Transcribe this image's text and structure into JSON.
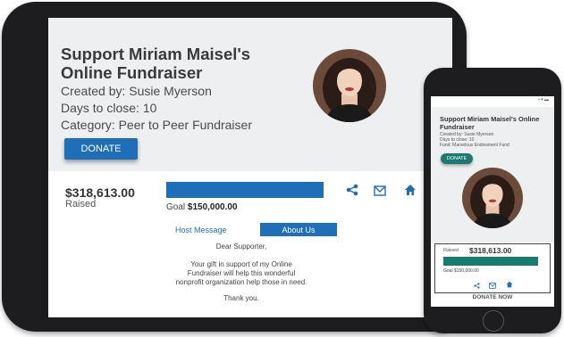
{
  "fundraiser": {
    "title": "Support Miriam Maisel's Online Fundraiser",
    "created_by": "Created by: Susie Myerson",
    "days_to_close": "Days to close: 10",
    "category": "Category: Peer to Peer Fundraiser",
    "donate_label": "DONATE",
    "raised_amount": "$318,613.00",
    "raised_label": "Raised",
    "goal_label": "Goal",
    "goal_amount": "$150,000.00",
    "progress_fraction": 1.0
  },
  "tabs": {
    "host_message": "Host Message",
    "about_us": "About Us"
  },
  "message": {
    "greeting": "Dear Supporter,",
    "body": "Your gift in support of my Online Fundraiser will help this wonderful nonprofit organization help those in need.",
    "closing": "Thank you."
  },
  "phone": {
    "title": "Support Miriam Maisel's Online Fundraiser",
    "created_by": "Created by: Susie Myerson",
    "days_to_close": "Days to close: 10",
    "fund": "Fund: Marvelous Endowment Fund",
    "donate_label": "DONATE",
    "raised_label": "Raised",
    "raised_amount": "$318,613.00",
    "goal_text": "Goal $150,000.00",
    "donate_now_label": "DONATE NOW"
  },
  "icons": {
    "share": "share-icon",
    "email": "email-icon",
    "home": "home-icon"
  },
  "colors": {
    "tablet_accent": "#1e6fb8",
    "phone_accent": "#1b7a70"
  }
}
